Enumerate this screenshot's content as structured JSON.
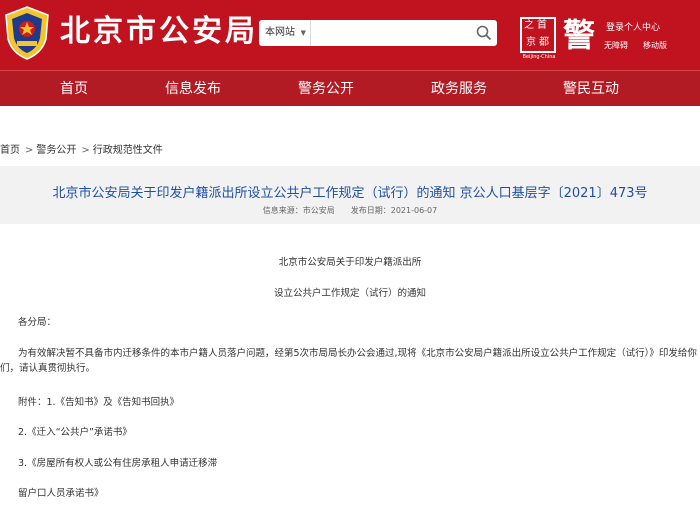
{
  "header": {
    "site_title": "北京市公安局",
    "search": {
      "scope": "本网站",
      "placeholder": ""
    },
    "logo1_glyphs": [
      "之",
      "首",
      "京",
      "都"
    ],
    "logo1_caption": "Beijing·China",
    "logo2_glyph": "警",
    "user_center": "登录个人中心",
    "link_a": "无障碍",
    "link_b": "移动版"
  },
  "nav": {
    "items": [
      "首页",
      "信息发布",
      "警务公开",
      "政务服务",
      "警民互动"
    ]
  },
  "breadcrumb": {
    "items": [
      "首页",
      "警务公开",
      "行政规范性文件"
    ],
    "separator": ">"
  },
  "article": {
    "title": "北京市公安局关于印发户籍派出所设立公共户工作规定（试行）的通知 京公人口基层字〔2021〕473号",
    "source": "信息来源：市公安局",
    "date": "发布日期：2021-06-07",
    "heading1": "北京市公安局关于印发户籍派出所",
    "heading2": "设立公共户工作规定（试行）的通知",
    "salutation": "各分局：",
    "para1_line1": "为有效解决暂不具备市内迁移条件的本市户籍人员落户问题，经第5次市局局长办公会通过,现将《北京市公安局户籍派出所设立公共户工作规定（试行）》印发给你",
    "para1_line2": "们，请认真贯彻执行。",
    "attach1": "附件：1.《告知书》及《告知书回执》",
    "attach2": "2.《迁入“公共户”承诺书》",
    "attach3": "3.《房屋所有权人或公有住房承租人申请迁移滞",
    "attach3_cont": "留户口人员承诺书》"
  },
  "colors": {
    "header_red": "#c1121f",
    "nav_red": "#b31b24",
    "title_blue": "#1e4fa3",
    "band_gray": "#f2f2f2"
  }
}
